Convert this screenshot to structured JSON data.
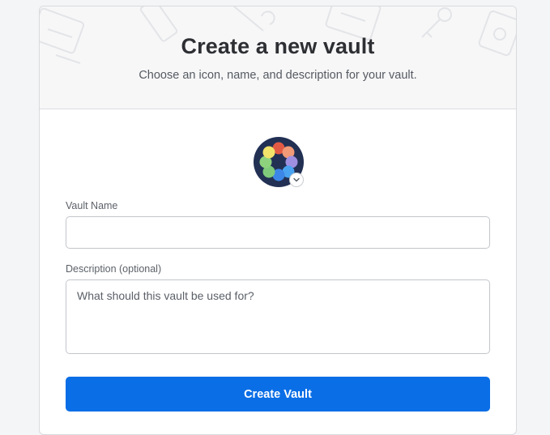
{
  "header": {
    "title": "Create a new vault",
    "subtitle": "Choose an icon, name, and description for your vault."
  },
  "icon_picker": {
    "icon": "rainbow-flower-icon",
    "colors": [
      "#e25a44",
      "#f09a78",
      "#9f8fe0",
      "#4aa3f0",
      "#3c86e8",
      "#7fcb7b",
      "#7fd07e",
      "#f2e36a",
      "#223054"
    ]
  },
  "form": {
    "name_label": "Vault Name",
    "name_value": "",
    "description_label": "Description (optional)",
    "description_placeholder": "What should this vault be used for?",
    "description_value": "",
    "submit_label": "Create Vault"
  },
  "colors": {
    "accent": "#0a6ee6",
    "header_bg": "#f7f7f8"
  }
}
